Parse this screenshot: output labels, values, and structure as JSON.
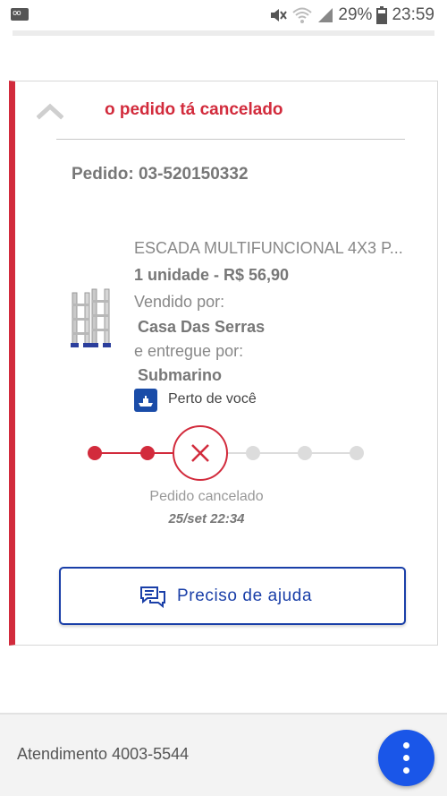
{
  "status_bar": {
    "battery": "29%",
    "time": "23:59",
    "icons": [
      "voicemail-icon",
      "mute-icon",
      "wifi-icon",
      "signal-icon",
      "battery-icon"
    ]
  },
  "order": {
    "status_title": "o pedido tá cancelado",
    "order_label": "Pedido: 03-520150332",
    "product": {
      "name": "ESCADA MULTIFUNCIONAL 4X3 P...",
      "qty_price": "1 unidade - R$ 56,90",
      "sold_by_label": "Vendido por:",
      "seller": "Casa Das Serras",
      "delivered_by_label": "e entregue por:",
      "deliverer": "Submarino",
      "near_you": "Perto de você"
    },
    "timeline": {
      "steps_done": 2,
      "current_state": "cancelled",
      "steps_pending": 3,
      "label": "Pedido cancelado",
      "date": "25/set 22:34"
    },
    "help_button": "Preciso de ajuda"
  },
  "footer": {
    "phone_text": "Atendimento 4003-5544",
    "menu_icon": "more-vertical-icon"
  },
  "colors": {
    "accent_red": "#d22b3c",
    "brand_blue": "#1a3fa8",
    "fab_blue": "#1a56e8"
  }
}
